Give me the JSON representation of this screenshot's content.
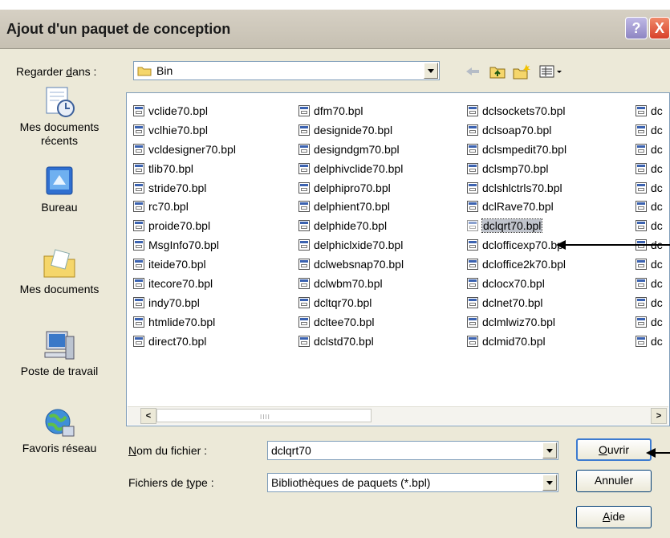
{
  "window": {
    "title": "Ajout d'un paquet de conception",
    "help_glyph": "?",
    "close_glyph": "X"
  },
  "lookin": {
    "label_prefix": "Regarder ",
    "label_accel": "d",
    "label_suffix": "ans :",
    "value": "Bin"
  },
  "toolbar": {
    "icons": [
      "back-arrow-icon",
      "up-folder-icon",
      "new-folder-icon",
      "views-menu-icon"
    ]
  },
  "places": [
    {
      "label": "Mes documents récents",
      "icon": "recent-documents-icon"
    },
    {
      "label": "Bureau",
      "icon": "desktop-icon"
    },
    {
      "label": "Mes documents",
      "icon": "my-documents-icon"
    },
    {
      "label": "Poste de travail",
      "icon": "my-computer-icon"
    },
    {
      "label": "Favoris réseau",
      "icon": "network-places-icon"
    }
  ],
  "files": {
    "col1": [
      "vclide70.bpl",
      "vclhie70.bpl",
      "vcldesigner70.bpl",
      "tlib70.bpl",
      "stride70.bpl",
      "rc70.bpl",
      "proide70.bpl",
      "MsgInfo70.bpl",
      "iteide70.bpl",
      "itecore70.bpl",
      "indy70.bpl",
      "htmlide70.bpl",
      "direct70.bpl"
    ],
    "col2": [
      "dfm70.bpl",
      "designide70.bpl",
      "designdgm70.bpl",
      "delphivclide70.bpl",
      "delphipro70.bpl",
      "delphient70.bpl",
      "delphide70.bpl",
      "delphiclxide70.bpl",
      "dclwebsnap70.bpl",
      "dclwbm70.bpl",
      "dcltqr70.bpl",
      "dcltee70.bpl",
      "dclstd70.bpl"
    ],
    "col3": [
      "dclsockets70.bpl",
      "dclsoap70.bpl",
      "dclsmpedit70.bpl",
      "dclsmp70.bpl",
      "dclshlctrls70.bpl",
      "dclRave70.bpl",
      "dclqrt70.bpl",
      "dclofficexp70.bpl",
      "dcloffice2k70.bpl",
      "dclocx70.bpl",
      "dclnet70.bpl",
      "dclmlwiz70.bpl",
      "dclmid70.bpl"
    ],
    "col4": [
      "dc",
      "dc",
      "dc",
      "dc",
      "dc",
      "dc",
      "dc",
      "dc",
      "dc",
      "dc",
      "dc",
      "dc",
      "dc"
    ],
    "selected": "dclqrt70.bpl"
  },
  "scrollbar": {
    "left_glyph": "<",
    "right_glyph": ">",
    "grip": "IIII"
  },
  "filename": {
    "label_accel": "N",
    "label_rest": "om du fichier :",
    "value": "dclqrt70"
  },
  "filetype": {
    "label_prefix": "Fichiers de ",
    "label_accel": "t",
    "label_suffix": "ype :",
    "value": "Bibliothèques de paquets (*.bpl)"
  },
  "buttons": {
    "open_accel": "O",
    "open_rest": "uvrir",
    "cancel": "Annuler",
    "help_accel": "A",
    "help_rest": "ide"
  },
  "colors": {
    "dialog_bg": "#ece9d8",
    "border_blue": "#7f9db9",
    "selection": "#c0c4cc"
  }
}
